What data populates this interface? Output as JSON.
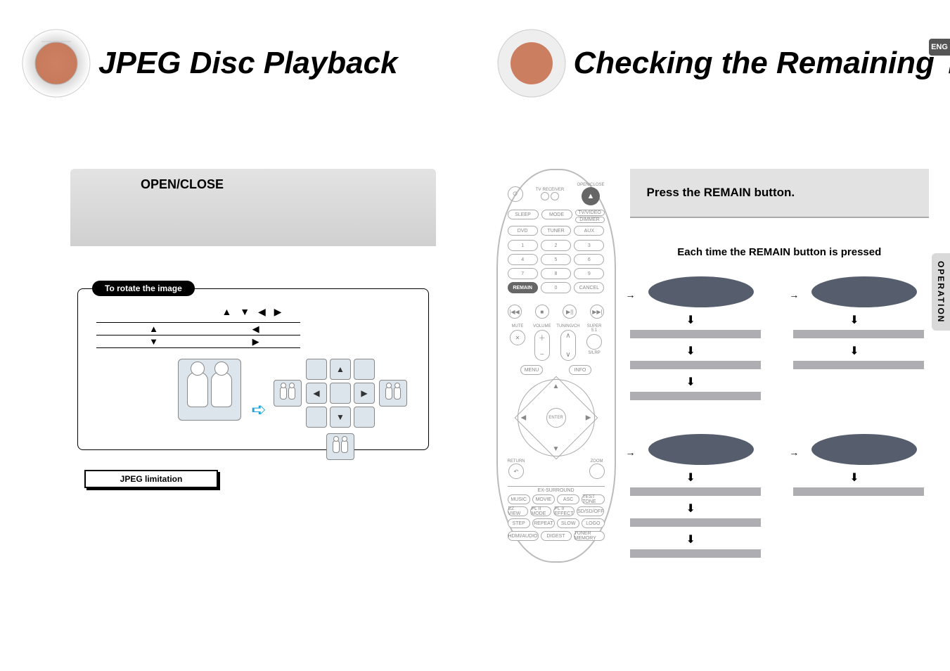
{
  "lang_badge": "ENG",
  "side_tab": "OPERATION",
  "left": {
    "title": "JPEG Disc Playback",
    "gray_bar_label": "OPEN/CLOSE",
    "rotate_title": "To rotate the image",
    "rotate_glyphs": "▲ ▼ ◀ ▶",
    "rotate_rows": [
      {
        "c1": "▲",
        "c2": "◀"
      },
      {
        "c1": "▼",
        "c2": "▶"
      }
    ],
    "big_arrow": "➪",
    "nav_glyphs": {
      "up": "▲",
      "down": "▼",
      "left": "◀",
      "right": "▶"
    },
    "jpeg_limitation_label": "JPEG limitation"
  },
  "right": {
    "title": "Checking the Remaining Time",
    "instr": "Press the REMAIN button.",
    "sub_instr": "Each time the REMAIN button is pressed",
    "mode_columns": [
      {
        "oval": true,
        "bars": 3,
        "arrows_between": 3
      },
      {
        "oval": true,
        "bars": 2,
        "arrows_between": 2
      },
      {
        "oval": true,
        "bars": 3,
        "arrows_between": 3
      },
      {
        "oval": true,
        "bars": 1,
        "arrows_between": 1
      }
    ]
  },
  "remote": {
    "top": {
      "power": "⏻",
      "tv": "TV",
      "receiver": "RECEIVER",
      "open_close_label": "OPEN/CLOSE",
      "open_close": "▲"
    },
    "row_mode": {
      "a": "SLEEP",
      "b": "MODE",
      "c": "TV/VIDEO",
      "c_sub": "DIMMER"
    },
    "row_src": {
      "a": "DVD",
      "b": "TUNER",
      "c": "AUX"
    },
    "keypad": [
      "1",
      "2",
      "3",
      "4",
      "5",
      "6",
      "7",
      "8",
      "9"
    ],
    "remain_row": {
      "a": "REMAIN",
      "b": "0",
      "c": "CANCEL"
    },
    "transport": {
      "prev": "|◀◀",
      "stop": "■",
      "play": "▶||",
      "next": "▶▶|"
    },
    "vol_label": "VOLUME",
    "tune_label": "TUNING/CH",
    "mute": "MUTE",
    "super": "SUPER 5.1",
    "slrp": "S/LRP",
    "menu": "MENU",
    "info": "INFO",
    "enter": "ENTER",
    "return": "RETURN",
    "zoom": "ZOOM",
    "surround_label": "EX-SURROUND",
    "grid4_r1": [
      "MUSIC",
      "MOVIE",
      "ASC",
      "TEST TONE"
    ],
    "grid4_r2": [
      "EZ VIEW",
      "PL II MODE",
      "PL II EFFECT",
      "SD/SD/OFF"
    ],
    "grid4_r3": [
      "STEP",
      "REPEAT",
      "SLOW",
      "LOGO"
    ],
    "grid3": [
      "HDMI/AUDIO",
      "DIGEST",
      "TUNER MEMORY"
    ]
  }
}
